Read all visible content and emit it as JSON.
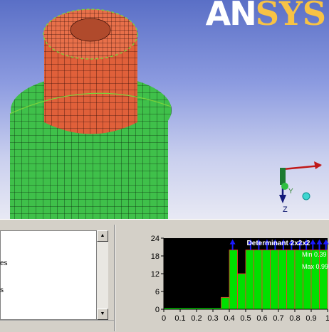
{
  "logo": {
    "text_a": "AN",
    "text_b": "SYS"
  },
  "triad": {
    "y_label": "Y",
    "z_label": "Z"
  },
  "list": {
    "line1": "es",
    "line2": "s"
  },
  "scrollbar": {
    "up_glyph": "▲",
    "down_glyph": "▼"
  },
  "colors": {
    "upper_mesh": "#e0603a",
    "lower_mesh": "#3fc04a",
    "histogram_bar": "#00e000",
    "histogram_bg": "#000000",
    "marker": "#1a1aff"
  },
  "chart_data": {
    "type": "bar",
    "title": "Determinant 2x2x2",
    "annotations": [
      "Min 0.39",
      "Max 0.997"
    ],
    "x_ticks": [
      "0",
      "0.1",
      "0.2",
      "0.3",
      "0.4",
      "0.5",
      "0.6",
      "0.7",
      "0.8",
      "0.9",
      "1"
    ],
    "y_ticks": [
      "0",
      "6",
      "12",
      "18",
      "24"
    ],
    "xlim": [
      0,
      1
    ],
    "ylim": [
      0,
      24
    ],
    "bin_width": 0.05,
    "bins": [
      {
        "x": 0.35,
        "value": 4
      },
      {
        "x": 0.4,
        "value": 20
      },
      {
        "x": 0.45,
        "value": 12
      },
      {
        "x": 0.5,
        "value": 20
      },
      {
        "x": 0.55,
        "value": 20
      },
      {
        "x": 0.6,
        "value": 20
      },
      {
        "x": 0.65,
        "value": 20
      },
      {
        "x": 0.7,
        "value": 20
      },
      {
        "x": 0.75,
        "value": 20
      },
      {
        "x": 0.8,
        "value": 20
      },
      {
        "x": 0.85,
        "value": 20
      },
      {
        "x": 0.9,
        "value": 20
      },
      {
        "x": 0.95,
        "value": 20
      }
    ],
    "markers": [
      0.42,
      0.53,
      0.58,
      0.63,
      0.68,
      0.73,
      0.78,
      0.83,
      0.87,
      0.91,
      0.95,
      0.99
    ]
  }
}
